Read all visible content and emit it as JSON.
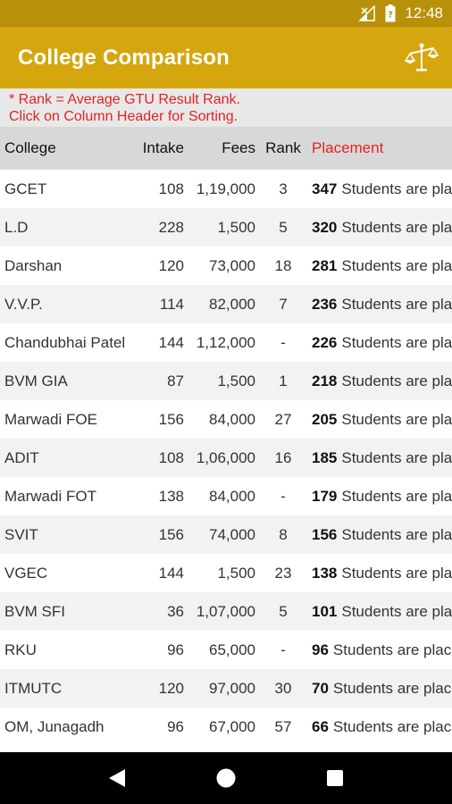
{
  "status_bar": {
    "time": "12:48"
  },
  "app_bar": {
    "title": "College Comparison",
    "compare_icon": "balance-scale-icon"
  },
  "note": {
    "line1": "* Rank = Average GTU Result Rank.",
    "line2": "Click on Column Header for Sorting."
  },
  "columns": {
    "college": "College",
    "intake": "Intake",
    "fees": "Fees",
    "rank": "Rank",
    "placement": "Placement"
  },
  "colors": {
    "accent": "#d4a70f",
    "status": "#b8900a",
    "highlight": "#e02424"
  },
  "rows": [
    {
      "college": "GCET",
      "intake": "108",
      "fees": "1,19,000",
      "rank": "3",
      "placed": "347",
      "placement_text": "Students are pla"
    },
    {
      "college": "L.D",
      "intake": "228",
      "fees": "1,500",
      "rank": "5",
      "placed": "320",
      "placement_text": "Students are pla"
    },
    {
      "college": "Darshan",
      "intake": "120",
      "fees": "73,000",
      "rank": "18",
      "placed": "281",
      "placement_text": "Students are pla"
    },
    {
      "college": "V.V.P.",
      "intake": "114",
      "fees": "82,000",
      "rank": "7",
      "placed": "236",
      "placement_text": "Students are pla"
    },
    {
      "college": "Chandubhai Patel",
      "intake": "144",
      "fees": "1,12,000",
      "rank": "-",
      "placed": "226",
      "placement_text": "Students are pla"
    },
    {
      "college": "BVM GIA",
      "intake": "87",
      "fees": "1,500",
      "rank": "1",
      "placed": "218",
      "placement_text": "Students are pla"
    },
    {
      "college": "Marwadi FOE",
      "intake": "156",
      "fees": "84,000",
      "rank": "27",
      "placed": "205",
      "placement_text": "Students are pla"
    },
    {
      "college": "ADIT",
      "intake": "108",
      "fees": "1,06,000",
      "rank": "16",
      "placed": "185",
      "placement_text": "Students are pla"
    },
    {
      "college": "Marwadi FOT",
      "intake": "138",
      "fees": "84,000",
      "rank": "-",
      "placed": "179",
      "placement_text": "Students are pla"
    },
    {
      "college": "SVIT",
      "intake": "156",
      "fees": "74,000",
      "rank": "8",
      "placed": "156",
      "placement_text": "Students are pla"
    },
    {
      "college": "VGEC",
      "intake": "144",
      "fees": "1,500",
      "rank": "23",
      "placed": "138",
      "placement_text": "Students are pla"
    },
    {
      "college": "BVM SFI",
      "intake": "36",
      "fees": "1,07,000",
      "rank": "5",
      "placed": "101",
      "placement_text": "Students are pla"
    },
    {
      "college": "RKU",
      "intake": "96",
      "fees": "65,000",
      "rank": "-",
      "placed": "96",
      "placement_text": "Students are plac"
    },
    {
      "college": "ITMUTC",
      "intake": "120",
      "fees": "97,000",
      "rank": "30",
      "placed": "70",
      "placement_text": "Students are plac"
    },
    {
      "college": "OM, Junagadh",
      "intake": "96",
      "fees": "67,000",
      "rank": "57",
      "placed": "66",
      "placement_text": "Students are plac"
    }
  ],
  "nav_bar": {
    "back_icon": "back-icon",
    "home_icon": "home-icon",
    "recents_icon": "recents-icon"
  }
}
